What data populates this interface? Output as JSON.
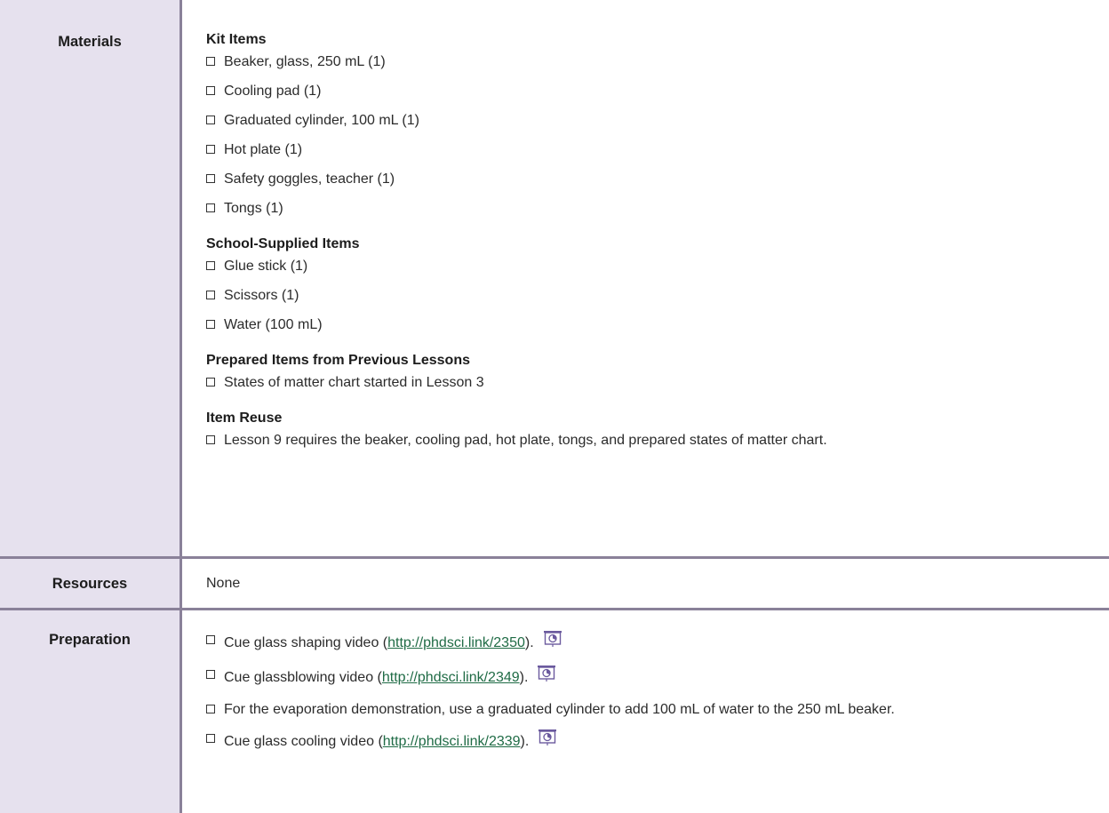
{
  "materials": {
    "label": "Materials",
    "sections": [
      {
        "heading": "Kit Items",
        "items": [
          "Beaker, glass, 250 mL (1)",
          "Cooling pad (1)",
          "Graduated cylinder, 100 mL (1)",
          "Hot plate (1)",
          "Safety goggles, teacher (1)",
          "Tongs (1)"
        ]
      },
      {
        "heading": "School-Supplied Items",
        "items": [
          "Glue stick (1)",
          "Scissors (1)",
          "Water (100 mL)"
        ]
      },
      {
        "heading": "Prepared Items from Previous Lessons",
        "items": [
          "States of matter chart started in Lesson 3"
        ]
      },
      {
        "heading": "Item Reuse",
        "items": [
          "Lesson 9 requires the beaker, cooling pad, hot plate, tongs, and prepared states of matter chart."
        ]
      }
    ]
  },
  "resources": {
    "label": "Resources",
    "value": "None"
  },
  "preparation": {
    "label": "Preparation",
    "items": [
      {
        "before": "Cue glass shaping video (",
        "link": "http://phdsci.link/2350",
        "after": ").",
        "icon": "projector-icon"
      },
      {
        "before": "Cue glassblowing video (",
        "link": "http://phdsci.link/2349",
        "after": ").",
        "icon": "projector-icon"
      },
      {
        "before": "For the evaporation demonstration, use a graduated cylinder to add 100 mL of water to the 250 mL beaker.",
        "link": "",
        "after": "",
        "icon": ""
      },
      {
        "before": "Cue glass cooling video (",
        "link": "http://phdsci.link/2339",
        "after": ").",
        "icon": "projector-icon"
      }
    ]
  },
  "colors": {
    "header_bg": "#e6e1ee",
    "border": "#8a8199",
    "link": "#1f6b45",
    "icon_purple": "#6b5a9e"
  }
}
